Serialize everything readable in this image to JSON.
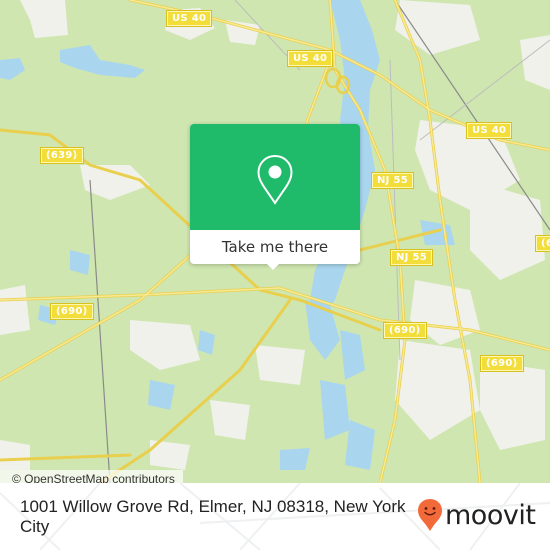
{
  "map": {
    "colors": {
      "land": "#cfe6b0",
      "water": "#a9d6ee",
      "urban": "#f1f1ec",
      "road_major": "#f4de6a",
      "rail": "#8a8a8a"
    },
    "road_labels": [
      {
        "id": "us40-a",
        "text": "US 40"
      },
      {
        "id": "us40-b",
        "text": "US 40"
      },
      {
        "id": "us40-c",
        "text": "US 40"
      },
      {
        "id": "cr639",
        "text": "(639)"
      },
      {
        "id": "nj55-a",
        "text": "NJ 55"
      },
      {
        "id": "nj55-b",
        "text": "NJ 55"
      },
      {
        "id": "cr690-a",
        "text": "(690)"
      },
      {
        "id": "cr690-b",
        "text": "(690)"
      },
      {
        "id": "cr690-c",
        "text": "(690)"
      },
      {
        "id": "cr-right",
        "text": "(6"
      }
    ],
    "popup": {
      "icon": "location-pin-icon",
      "action_label": "Take me there",
      "accent": "#1fbb6b"
    },
    "attribution": "© OpenStreetMap contributors"
  },
  "footer": {
    "address": "1001 Willow Grove Rd, Elmer, NJ 08318, New York City",
    "brand": {
      "name": "moovit",
      "icon": "moovit-smiley-pin-icon",
      "icon_color": "#f26a3a"
    }
  }
}
